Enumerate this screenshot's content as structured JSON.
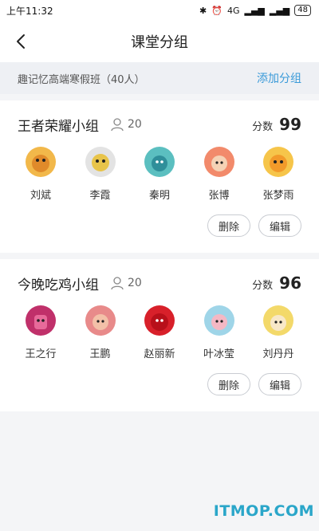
{
  "status_bar": {
    "time": "上午11:32",
    "network": "4G",
    "battery": "48"
  },
  "nav": {
    "title": "课堂分组"
  },
  "class_info": {
    "name": "趣记忆高端寒假班（40人）",
    "add_group_label": "添加分组"
  },
  "groups": [
    {
      "name": "王者荣耀小组",
      "member_count": "20",
      "score_label": "分数",
      "score": "99",
      "members": [
        {
          "name": "刘斌",
          "avatar_color": "#f2b84a"
        },
        {
          "name": "李霞",
          "avatar_color": "#d8d8d8"
        },
        {
          "name": "秦明",
          "avatar_color": "#5bbfc0"
        },
        {
          "name": "张博",
          "avatar_color": "#f28a6b"
        },
        {
          "name": "张梦雨",
          "avatar_color": "#f6c54a"
        }
      ],
      "delete_label": "删除",
      "edit_label": "编辑"
    },
    {
      "name": "今晚吃鸡小组",
      "member_count": "20",
      "score_label": "分数",
      "score": "96",
      "members": [
        {
          "name": "王之行",
          "avatar_color": "#c0306a"
        },
        {
          "name": "王鹏",
          "avatar_color": "#e88a8a"
        },
        {
          "name": "赵丽新",
          "avatar_color": "#d8202a"
        },
        {
          "name": "叶冰莹",
          "avatar_color": "#9fd5e8"
        },
        {
          "name": "刘丹丹",
          "avatar_color": "#f3d96a"
        }
      ],
      "delete_label": "删除",
      "edit_label": "编辑"
    }
  ],
  "watermark": "ITMOP.COM"
}
